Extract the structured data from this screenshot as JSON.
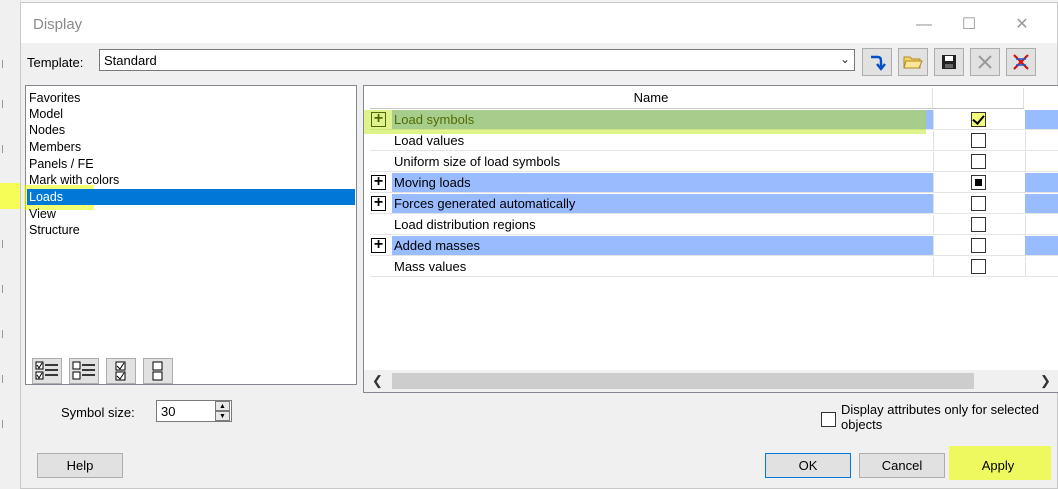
{
  "dialog": {
    "title": "Display",
    "window_controls": [
      "minimize-icon",
      "maximize-icon",
      "close-icon"
    ]
  },
  "template": {
    "label": "Template:",
    "value": "Standard",
    "toolbar_icons": [
      "apply-template-icon",
      "open-folder-icon",
      "save-icon",
      "delete-icon",
      "reset-icon"
    ]
  },
  "categories": [
    {
      "label": "Favorites"
    },
    {
      "label": "Model"
    },
    {
      "label": "Nodes"
    },
    {
      "label": "Members"
    },
    {
      "label": "Panels / FE"
    },
    {
      "label": "Mark with colors"
    },
    {
      "label": "Loads",
      "selected": true
    },
    {
      "label": "View"
    },
    {
      "label": "Structure"
    }
  ],
  "options": {
    "header": "Name",
    "rows": [
      {
        "label": "Load symbols",
        "group": true,
        "state": "checked"
      },
      {
        "label": "Load values",
        "group": false,
        "state": "unchecked"
      },
      {
        "label": "Uniform size of load symbols",
        "group": false,
        "state": "unchecked"
      },
      {
        "label": "Moving loads",
        "group": true,
        "state": "indeterminate"
      },
      {
        "label": "Forces generated automatically",
        "group": true,
        "state": "unchecked"
      },
      {
        "label": "Load distribution regions",
        "group": false,
        "state": "unchecked"
      },
      {
        "label": "Added masses",
        "group": true,
        "state": "unchecked"
      },
      {
        "label": "Mass values",
        "group": false,
        "state": "unchecked"
      }
    ],
    "expander_glyph": "+"
  },
  "symbol_size": {
    "label": "Symbol size:",
    "value": "30"
  },
  "attributes_only": {
    "label": "Display attributes only for selected objects",
    "checked": false
  },
  "buttons": {
    "help": "Help",
    "ok": "OK",
    "cancel": "Cancel",
    "apply": "Apply"
  },
  "highlight_color": "#e8ff00",
  "selection_color": "#0078d7",
  "group_row_color": "#99bbff"
}
